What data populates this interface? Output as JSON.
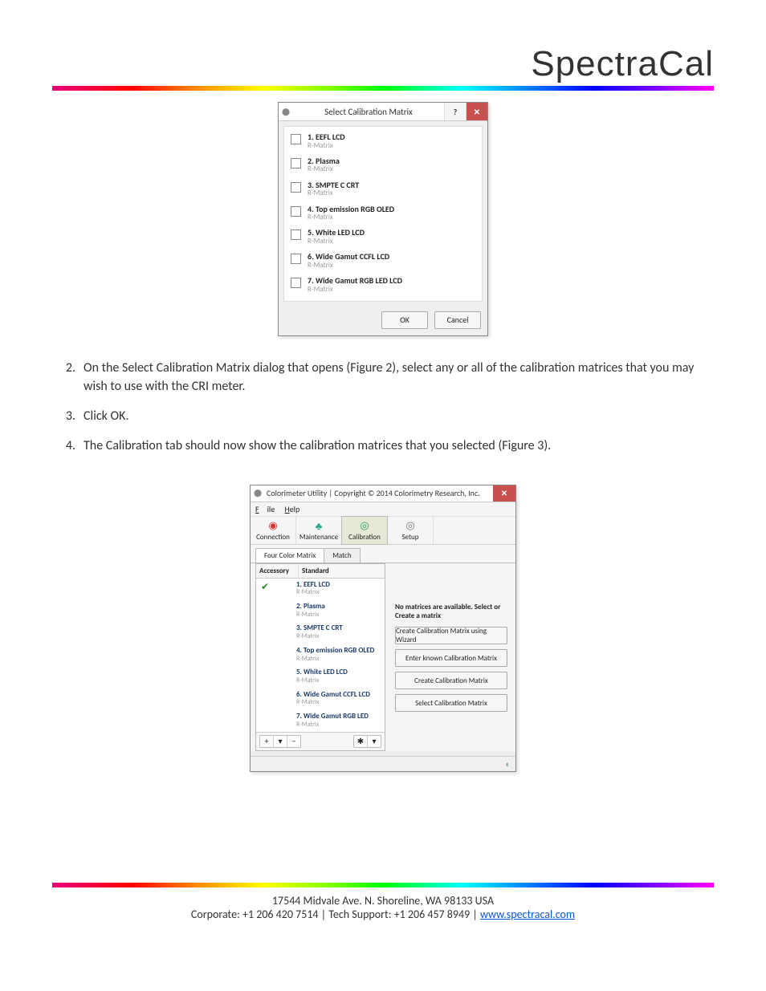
{
  "brand": "SpectraCal",
  "dialog1": {
    "title": "Select Calibration Matrix",
    "help_glyph": "?",
    "close_glyph": "✕",
    "items": [
      {
        "primary": "1. EEFL LCD",
        "secondary": "R-Matrix"
      },
      {
        "primary": "2. Plasma",
        "secondary": "R-Matrix"
      },
      {
        "primary": "3. SMPTE C CRT",
        "secondary": "R-Matrix"
      },
      {
        "primary": "4. Top emission RGB OLED",
        "secondary": "R-Matrix"
      },
      {
        "primary": "5. White LED LCD",
        "secondary": "R-Matrix"
      },
      {
        "primary": "6. Wide Gamut CCFL LCD",
        "secondary": "R-Matrix"
      },
      {
        "primary": "7. Wide Gamut RGB LED LCD",
        "secondary": "R-Matrix"
      }
    ],
    "ok": "OK",
    "cancel": "Cancel"
  },
  "steps": {
    "s2_num": "2.",
    "s2": "On the Select Calibration Matrix dialog that opens (Figure 2), select any or all of the calibration matrices that you may wish to use with the CRI meter.",
    "s3_num": "3.",
    "s3": "Click OK.",
    "s4_num": "4.",
    "s4": "The Calibration tab should now show the calibration matrices that you selected (Figure 3)."
  },
  "dialog2": {
    "title": "Colorimeter Utility | Copyright © 2014 Colorimetry Research, Inc.",
    "close_glyph": "✕",
    "menu_file": "File",
    "menu_help": "Help",
    "toolbar": {
      "connection": "Connection",
      "maintenance": "Maintenance",
      "calibration": "Calibration",
      "setup": "Setup"
    },
    "subtabs": {
      "four_color": "Four Color Matrix",
      "match": "Match"
    },
    "left_header": {
      "accessory": "Accessory",
      "standard": "Standard"
    },
    "left_items": [
      {
        "primary": "1. EEFL LCD",
        "secondary": "R-Matrix",
        "checked": true
      },
      {
        "primary": "2. Plasma",
        "secondary": "R-Matrix",
        "checked": false
      },
      {
        "primary": "3. SMPTE C CRT",
        "secondary": "R-Matrix",
        "checked": false
      },
      {
        "primary": "4. Top emission RGB OLED",
        "secondary": "R-Matrix",
        "checked": false
      },
      {
        "primary": "5. White LED LCD",
        "secondary": "R-Matrix",
        "checked": false
      },
      {
        "primary": "6. Wide Gamut CCFL LCD",
        "secondary": "R-Matrix",
        "checked": false
      },
      {
        "primary": "7. Wide Gamut RGB LED",
        "secondary": "R-Matrix",
        "checked": false
      }
    ],
    "left_ctrls": {
      "plus": "+",
      "dropdown": "▾",
      "minus": "−",
      "gear": "✱",
      "gear_dd": "▾"
    },
    "right": {
      "msg": "No matrices are available. Select or Create a matrix",
      "b1": "Create Calibration Matrix using Wizard",
      "b2": "Enter known Calibration Matrix",
      "b3": "Create Calibration Matrix",
      "b4": "Select Calibration Matrix"
    }
  },
  "footer": {
    "line1": "17544 Midvale Ave. N. Shoreline, WA 98133 USA",
    "corporate_label": "Corporate: ",
    "corporate_phone": "+1 206 420 7514",
    "sep": "   |   ",
    "tech_label": "Tech Support: ",
    "tech_phone": "+1 206 457 8949",
    "link_text": "www.spectracal.com",
    "link_href": "http://www.spectracal.com"
  }
}
